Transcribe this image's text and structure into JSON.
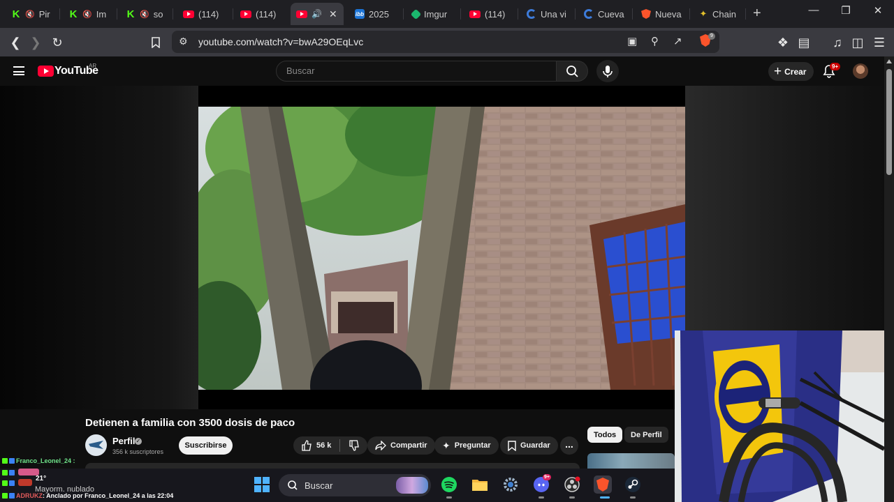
{
  "browser": {
    "tabs": [
      {
        "icon": "kick-icon",
        "muted": true,
        "label": "Pir"
      },
      {
        "icon": "kick-icon",
        "muted": true,
        "label": "Im"
      },
      {
        "icon": "kick-icon",
        "muted": true,
        "label": "so"
      },
      {
        "icon": "youtube-icon",
        "muted": false,
        "label": "(114)"
      },
      {
        "icon": "youtube-icon",
        "muted": false,
        "label": "(114)"
      },
      {
        "icon": "youtube-icon",
        "muted": false,
        "label": "",
        "active": true,
        "audio": true
      },
      {
        "icon": "ibb-icon",
        "muted": false,
        "label": "2025"
      },
      {
        "icon": "imgur-icon",
        "muted": false,
        "label": "Imgur"
      },
      {
        "icon": "youtube-icon",
        "muted": false,
        "label": "(114)"
      },
      {
        "icon": "edge-circle-icon",
        "muted": false,
        "label": "Una vi"
      },
      {
        "icon": "edge-circle-icon",
        "muted": false,
        "label": "Cueva"
      },
      {
        "icon": "brave-icon",
        "muted": false,
        "label": "Nueva"
      },
      {
        "icon": "chain-icon",
        "muted": false,
        "label": "Chain"
      }
    ],
    "url": "youtube.com/watch?v=bwA29OEqLvc",
    "brave_shield_count": "9"
  },
  "youtube": {
    "logo_text": "YouTube",
    "country_code": "AR",
    "search_placeholder": "Buscar",
    "create_label": "Crear",
    "notifications_badge": "9+"
  },
  "video": {
    "title": "Detienen a familia con 3500 dosis de paco",
    "channel": "Perfil",
    "subscribers": "356 k suscriptores",
    "subscribe_label": "Suscribirse",
    "likes": "56 k",
    "share_label": "Compartir",
    "ask_label": "Preguntar",
    "save_label": "Guardar",
    "more_label": "..."
  },
  "recommendations": {
    "chips": [
      "Todos",
      "De Perfil"
    ]
  },
  "taskbar": {
    "search_label": "Buscar",
    "weather_text": "Mayorm. nublado",
    "temperature": "21°",
    "discord_badge": "9+"
  },
  "chat": {
    "lines": [
      {
        "user": "Franco_Leonel_24",
        "text": ":",
        "color": "#6fe38a"
      },
      {
        "user": "_",
        "text": "",
        "color": "#ff5a5a"
      },
      {
        "user": "",
        "text": "",
        "color": "#6fe38a"
      },
      {
        "user": "ADRUKZ",
        "text": ": Anclado por Franco_Leonel_24 a las 22:04",
        "color": "#e05a5a"
      }
    ]
  }
}
